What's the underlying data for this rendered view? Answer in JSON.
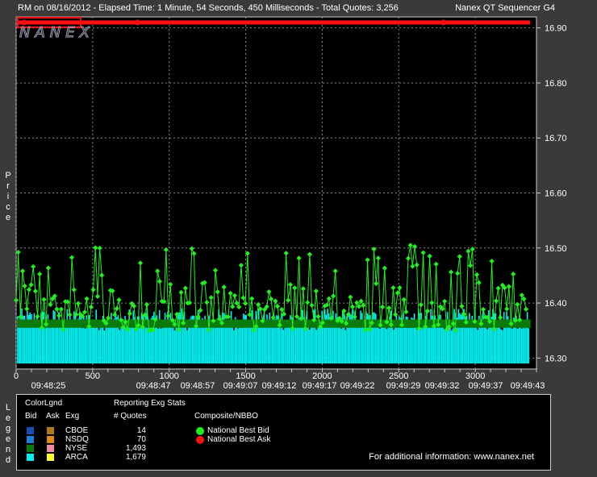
{
  "header": {
    "title_left": "RM on 08/16/2012  -  Elapsed Time: 1 Minute, 54 Seconds, 450 Milliseconds  -  Total Quotes: 3,256",
    "title_right": "Nanex QT Sequencer G4",
    "watermark": "NANEX"
  },
  "side_labels": {
    "y_axis": "Price",
    "legend": "Legend"
  },
  "colors": {
    "background": "#000000",
    "frame": "#3a3a3a",
    "grid": "#8a8a8a",
    "best_bid": "#22ee22",
    "best_ask": "#ff1010",
    "arca": "#00f0f0",
    "nyse": "#0a7a0a",
    "cboe_bid": "#1a4fb0",
    "cboe_ask": "#b07a1a",
    "nsdq_bid": "#1e7fd8",
    "nsdq_ask": "#e08a10",
    "nyse_ask": "#f08aa0",
    "arca_ask": "#ffff30"
  },
  "chart_data": {
    "type": "line",
    "ylim": [
      16.28,
      16.92
    ],
    "xlim": [
      0,
      3400
    ],
    "y_ticks": [
      "16.30",
      "16.40",
      "16.50",
      "16.60",
      "16.70",
      "16.80",
      "16.90"
    ],
    "x_ticks": [
      "0",
      "500",
      "1000",
      "1500",
      "2000",
      "2500",
      "3000"
    ],
    "time_labels": [
      "09:48:25",
      "09:48:47",
      "09:48:57",
      "09:49:07",
      "09:49:12",
      "09:49:17",
      "09:49:22",
      "09:49:29",
      "09:49:32",
      "09:49:37",
      "09:49:43"
    ],
    "grid": true,
    "series": [
      {
        "name": "National Best Bid",
        "color": "#22ee22",
        "typical_range": [
          16.35,
          16.51
        ],
        "typical_level": 16.39
      },
      {
        "name": "National Best Ask",
        "color": "#ff1010",
        "value": 16.91
      }
    ],
    "exchange_bid_levels": [
      {
        "exchange": "ARCA",
        "color": "#00f0f0",
        "low": 16.29,
        "typical": 16.37
      },
      {
        "exchange": "NYSE",
        "color": "#0a7a0a",
        "typical": 16.36
      }
    ]
  },
  "legend": {
    "color_legend_title": "ColorLgnd",
    "stats_title": "Reporting Exg Stats",
    "col_bid": "Bid",
    "col_ask": "Ask",
    "col_exg": "Exg",
    "col_quotes": "# Quotes",
    "composite_title": "Composite/NBBO",
    "rows": [
      {
        "exg": "CBOE",
        "quotes": "14"
      },
      {
        "exg": "NSDQ",
        "quotes": "70"
      },
      {
        "exg": "NYSE",
        "quotes": "1,493"
      },
      {
        "exg": "ARCA",
        "quotes": "1,679"
      }
    ],
    "nbbo": [
      {
        "label": "National Best Bid"
      },
      {
        "label": "National Best Ask"
      }
    ],
    "info": "For additional information: www.nanex.net"
  }
}
